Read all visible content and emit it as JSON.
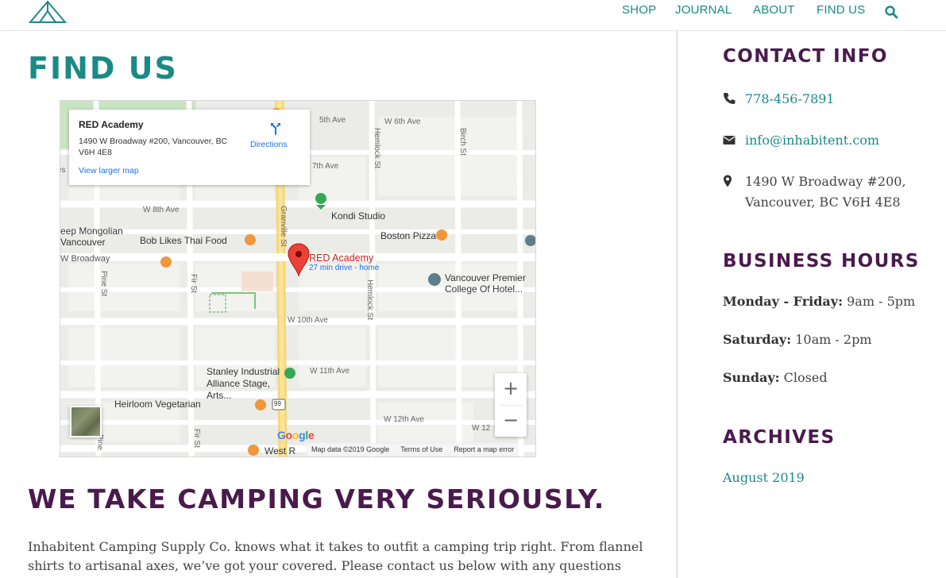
{
  "colors": {
    "teal": "#1a8a87",
    "plum": "#4a1a4d",
    "pin": "#d93025"
  },
  "header": {
    "logo_icon": "tent-logo-icon",
    "nav": [
      "SHOP",
      "JOURNAL",
      "ABOUT",
      "FIND US"
    ],
    "search_icon": "search-icon"
  },
  "main": {
    "title": "FIND US",
    "tagline": "WE TAKE CAMPING VERY SERIOUSLY.",
    "intro": "Inhabitent Camping Supply Co. knows what it takes to outfit a camping trip right. From flannel shirts to artisanal axes, we’ve got your covered. Please contact us below with any questions"
  },
  "map": {
    "card": {
      "name": "RED Academy",
      "address": "1490 W Broadway #200, Vancouver, BC V6H 4E8",
      "directions": "Directions",
      "larger_map": "View larger map"
    },
    "pin_label": "RED Academy",
    "pin_sub": "27 min drive - home",
    "pois": [
      "Kondi Studio",
      "Bob Likes Thai Food",
      "Boston Pizza",
      "Vancouver Premier College Of Hotel...",
      "Stanley Industrial Alliance Stage, Arts...",
      "Heirloom Vegetarian",
      "West R",
      "eep Mongolian Vancouver"
    ],
    "streets": [
      "W 6th Ave",
      "7th Ave",
      "W 8th Ave",
      "W Broadway",
      "W 10th Ave",
      "W 11th Ave",
      "W 12th Ave",
      "W 12",
      "Granville St",
      "Hemlock St",
      "Fir St",
      "Pine St",
      "Birch St",
      "5th Ave",
      "es",
      "Fir St",
      "Pine",
      "Hemlock St",
      "99"
    ],
    "zoom_in": "+",
    "zoom_out": "−",
    "google": "Google",
    "footer": [
      "Map data ©2019 Google",
      "Terms of Use",
      "Report a map error"
    ]
  },
  "sidebar": {
    "contact_heading": "CONTACT INFO",
    "phone": "778-456-7891",
    "email": "info@inhabitent.com",
    "address": "1490 W Broadway #200, Vancouver, BC V6H 4E8",
    "hours_heading": "BUSINESS HOURS",
    "hours": [
      {
        "day": "Monday - Friday:",
        "time": "9am - 5pm"
      },
      {
        "day": "Saturday:",
        "time": "10am - 2pm"
      },
      {
        "day": "Sunday:",
        "time": "Closed"
      }
    ],
    "archives_heading": "ARCHIVES",
    "archives": [
      "August 2019"
    ]
  }
}
